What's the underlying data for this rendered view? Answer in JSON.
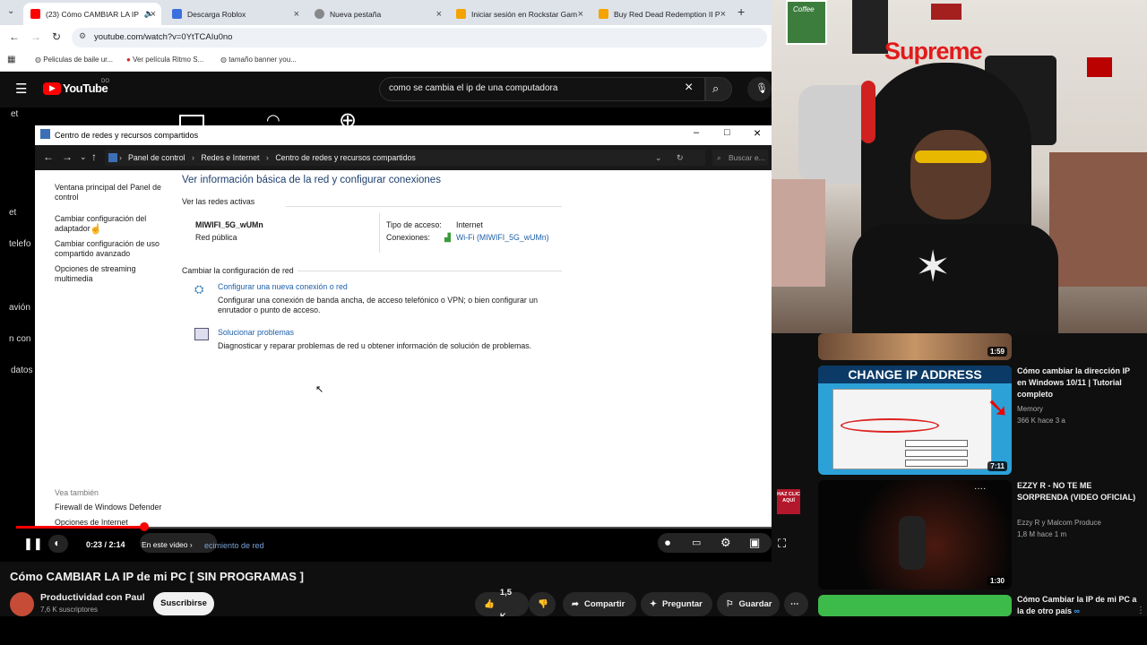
{
  "browser": {
    "tabs": [
      {
        "label": "(23) Cómo CAMBIAR LA IP",
        "active": true
      },
      {
        "label": "Descarga Roblox"
      },
      {
        "label": "Nueva pestaña"
      },
      {
        "label": "Iniciar sesión en Rockstar Gam"
      },
      {
        "label": "Buy Red Dead Redemption II P"
      }
    ],
    "new_tab": "+",
    "url": "youtube.com/watch?v=0YtTCAIu0no",
    "bookmarks": [
      "Peliculas de baile ur...",
      "Ver película Ritmo S...",
      "tamaño banner you..."
    ]
  },
  "youtube": {
    "logo": "YouTube",
    "logo_sup": "DO",
    "search_value": "como se cambia el ip de una computadora",
    "left_partial": [
      "et",
      "et",
      "telefo",
      "avión",
      "n con",
      "datos"
    ]
  },
  "window": {
    "title": "Centro de redes y recursos compartidos",
    "breadcrumb": [
      "Panel de control",
      "Redes e Internet",
      "Centro de redes y recursos compartidos"
    ],
    "search_placeholder": "Buscar e...",
    "sidebar": [
      "Ventana principal del Panel de control",
      "Cambiar configuración del adaptador",
      "Cambiar configuración de uso compartido avanzado",
      "Opciones de streaming multimedia"
    ],
    "see_also_heading": "Vea también",
    "see_also": [
      "Firewall de Windows Defender",
      "Opciones de Internet"
    ],
    "heading": "Ver información básica de la red y configurar conexiones",
    "active_networks_label": "Ver las redes activas",
    "network_name": "MIWIFI_5G_wUMn",
    "network_type": "Red pública",
    "access_type_label": "Tipo de acceso:",
    "access_type_value": "Internet",
    "connections_label": "Conexiones:",
    "connections_value": "Wi-Fi (MIWIFI_5G_wUMn)",
    "change_settings_label": "Cambiar la configuración de red",
    "setup_link": "Configurar una nueva conexión o red",
    "setup_desc": "Configurar una conexión de banda ancha, de acceso telefónico o VPN; o bien configurar un enrutador o punto de acceso.",
    "troubleshoot_link": "Solucionar problemas",
    "troubleshoot_desc": "Diagnosticar y reparar problemas de red u obtener información de solución de problemas.",
    "partial_bottom": "ecimiento de red"
  },
  "player": {
    "time": "0:23 / 2:14",
    "chapter": "En este video",
    "progress_fraction": 0.17,
    "ad_badge": "HAZ CLIC AQUÍ"
  },
  "video": {
    "title": "Cómo CAMBIAR LA IP de mi PC [ SIN PROGRAMAS ]",
    "channel": "Productividad con Paul",
    "subscribers": "7,6 K suscriptores",
    "subscribe": "Suscribirse",
    "likes": "1,5 K",
    "share": "Compartir",
    "ask": "Preguntar",
    "save": "Guardar"
  },
  "webcam": {
    "sign": "Supreme",
    "sticker": "Coffee"
  },
  "related": [
    {
      "duration": "1:59"
    },
    {
      "thumb_text": "CHANGE IP ADDRESS",
      "title": "Cómo cambiar la dirección IP en Windows 10/11 | Tutorial completo",
      "channel": "Memory",
      "stats": "366 K  hace 3 a",
      "duration": "7:11"
    },
    {
      "title": "EZZY R - NO TE ME SORPRENDA (VIDEO OFICIAL)",
      "channel": "Ezzy R  y Malcom Produce",
      "stats": "1,8 M  hace 1 m",
      "duration": "1:30"
    },
    {
      "title": "Cómo Cambiar la IP de mi PC a la de otro país",
      "link_symbol": "∞"
    }
  ]
}
